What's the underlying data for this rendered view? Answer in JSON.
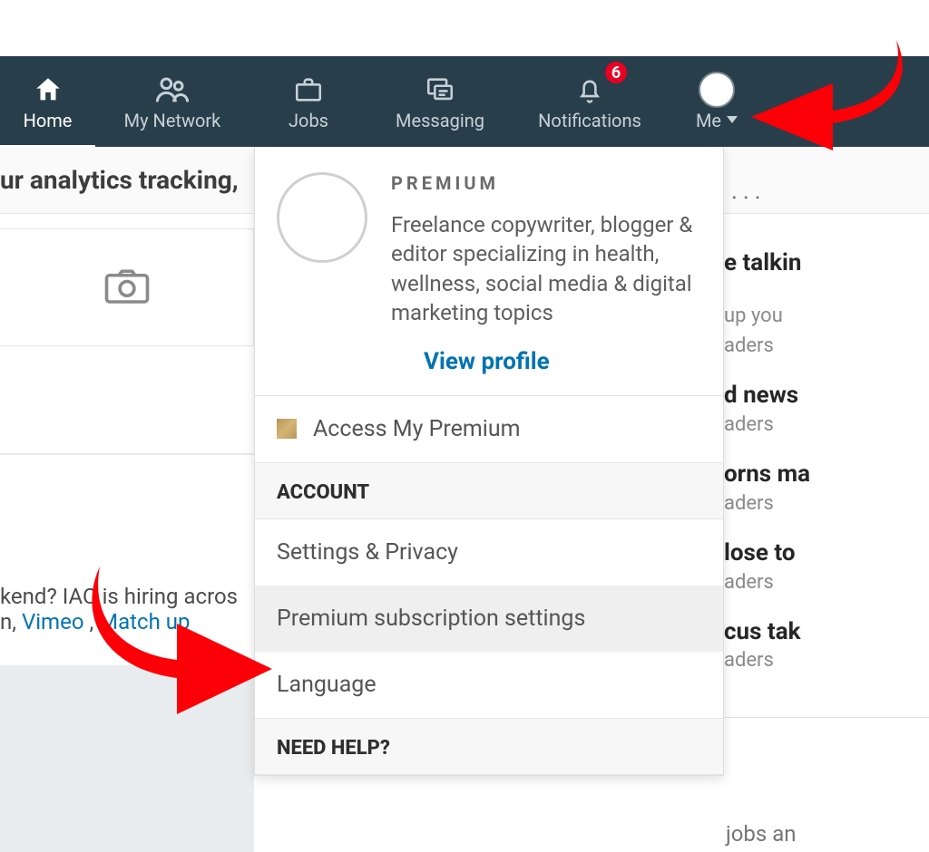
{
  "nav": {
    "home": "Home",
    "network": "My Network",
    "jobs": "Jobs",
    "messaging": "Messaging",
    "notifications": "Notifications",
    "notif_badge": "6",
    "me": "Me"
  },
  "background": {
    "strip": "ur analytics tracking,",
    "hiring_line": "kend? IAC is hiring acros",
    "link_vimeo": "Vimeo",
    "link_match_prefix": ", ",
    "link_match": "Match",
    "link_trail": "up",
    "ellipsis": "..."
  },
  "news": [
    {
      "head": "e talkin",
      "sub": "up you"
    },
    {
      "head": "",
      "sub": "aders"
    },
    {
      "head": "d news",
      "sub": "aders"
    },
    {
      "head": "orns ma",
      "sub": "aders"
    },
    {
      "head": "lose to",
      "sub": "aders"
    },
    {
      "head": "cus tak",
      "sub": "aders"
    }
  ],
  "right_jobs": "jobs an",
  "dropdown": {
    "premium_label": "PREMIUM",
    "bio": "Freelance copywriter, blogger & editor specializing in health, wellness, social media & digital marketing topics",
    "view_profile": "View profile",
    "access_premium": "Access My Premium",
    "account_header": "ACCOUNT",
    "settings_privacy": "Settings & Privacy",
    "premium_subscription": "Premium subscription settings",
    "language": "Language",
    "need_help_header": "NEED HELP?"
  }
}
